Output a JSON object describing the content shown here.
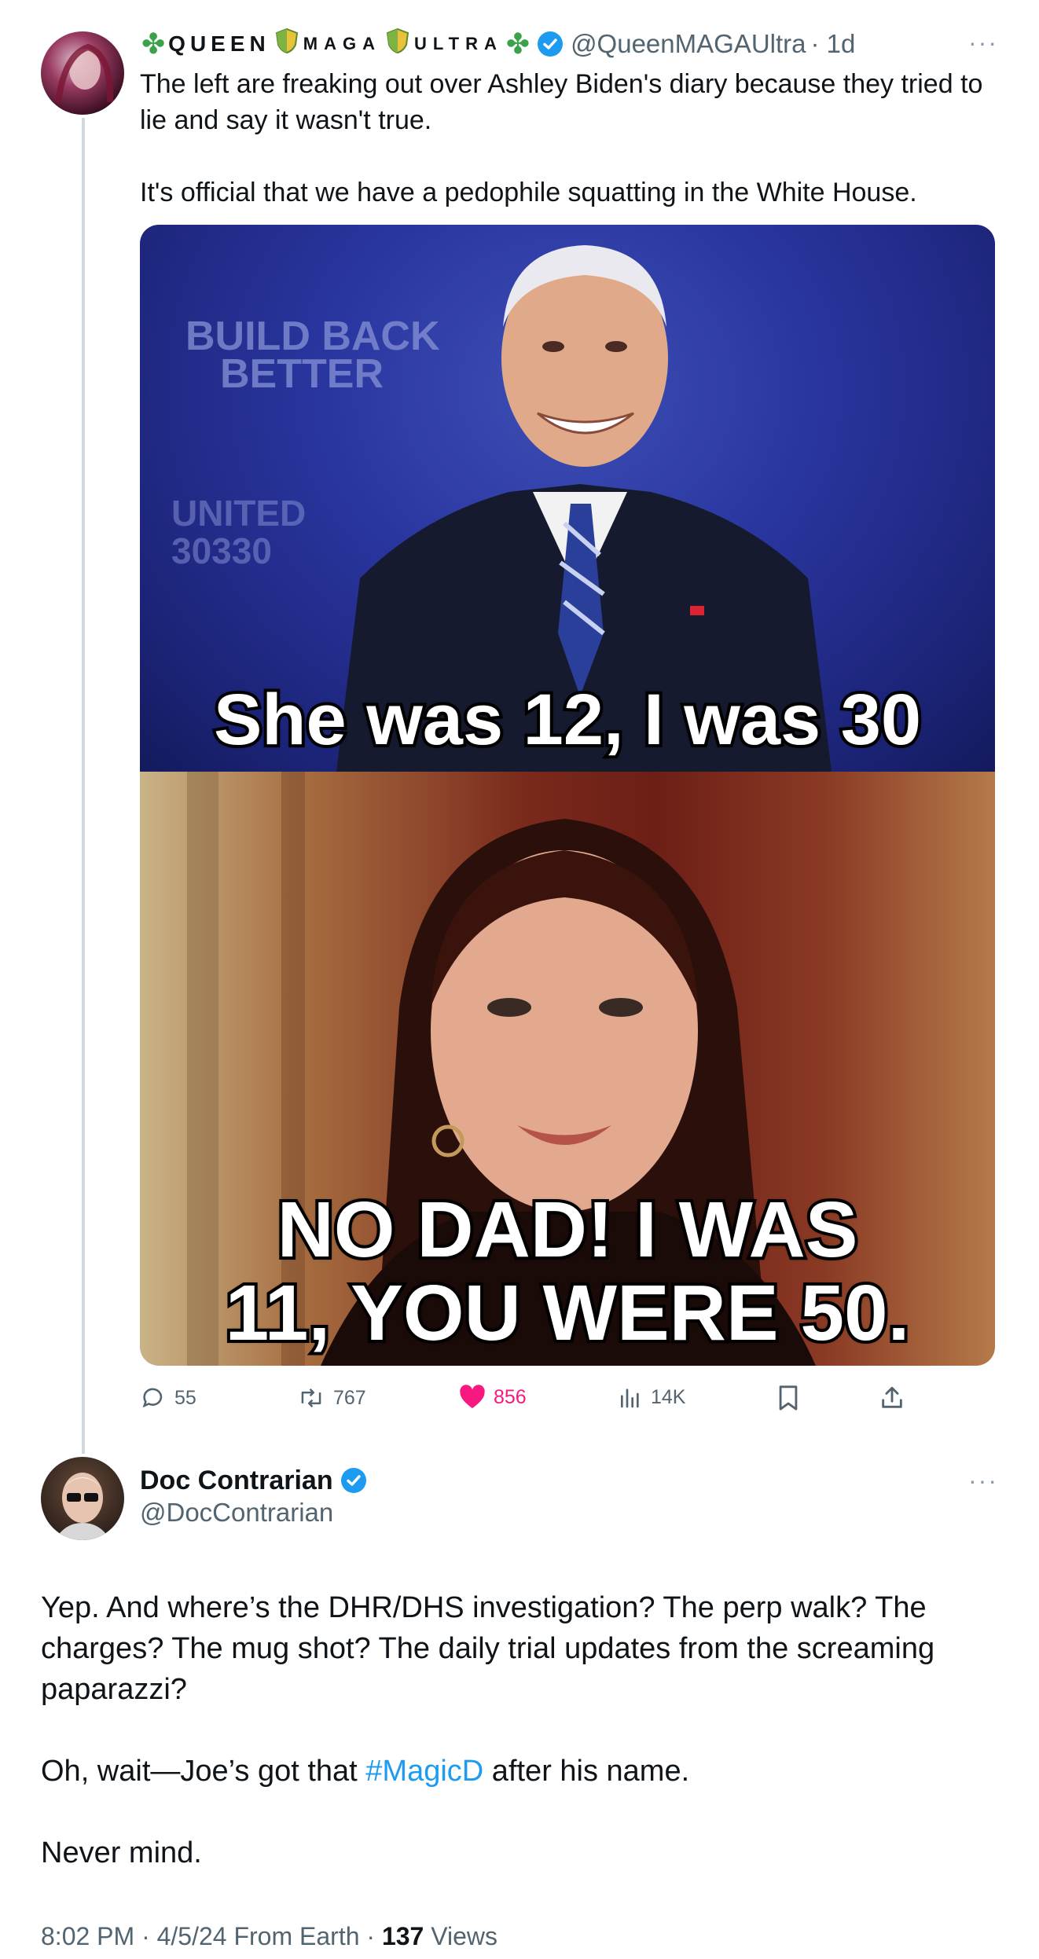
{
  "tweet1": {
    "display_name_parts": [
      "QUEEN",
      "MAGA",
      "ULTRA"
    ],
    "handle": "@QueenMAGAUltra",
    "time": "· 1d",
    "more": "···",
    "text_line1": "The left are freaking out over Ashley Biden's diary because they tried to",
    "text_line2": "lie and say it wasn't true.",
    "text_line3": "It's official that we have a pedophile squatting in the White House.",
    "meme": {
      "top_caption": "She was 12, I was 30",
      "bottom_caption_line1": "NO DAD!  I WAS",
      "bottom_caption_line2": "11, YOU WERE 50.",
      "backdrop_text_1": "BUILD BACK",
      "backdrop_text_2": "BETTER",
      "backdrop_text_3": "UNITED",
      "backdrop_text_4": "30330"
    },
    "actions": {
      "reply_count": "55",
      "retweet_count": "767",
      "like_count": "856",
      "views_count": "14K"
    }
  },
  "tweet2": {
    "display_name": "Doc Contrarian",
    "handle": "@DocContrarian",
    "more": "···",
    "para1_line1": "Yep. And where’s the DHR/DHS investigation? The perp walk? The",
    "para1_line2": "charges? The mug shot? The daily trial updates from the screaming",
    "para1_line3": "paparazzi?",
    "para2_before": "Oh, wait—Joe’s got that ",
    "para2_hashtag": "#MagicD",
    "para2_after": " after his name.",
    "para3": "Never mind.",
    "meta_time": "8:02 PM · 4/5/24 From Earth · ",
    "meta_views_count": "137",
    "meta_views_label": " Views"
  },
  "colors": {
    "accent": "#1d9bf0",
    "like": "#f91880",
    "muted": "#536471",
    "thread_line": "#cfd9de"
  }
}
